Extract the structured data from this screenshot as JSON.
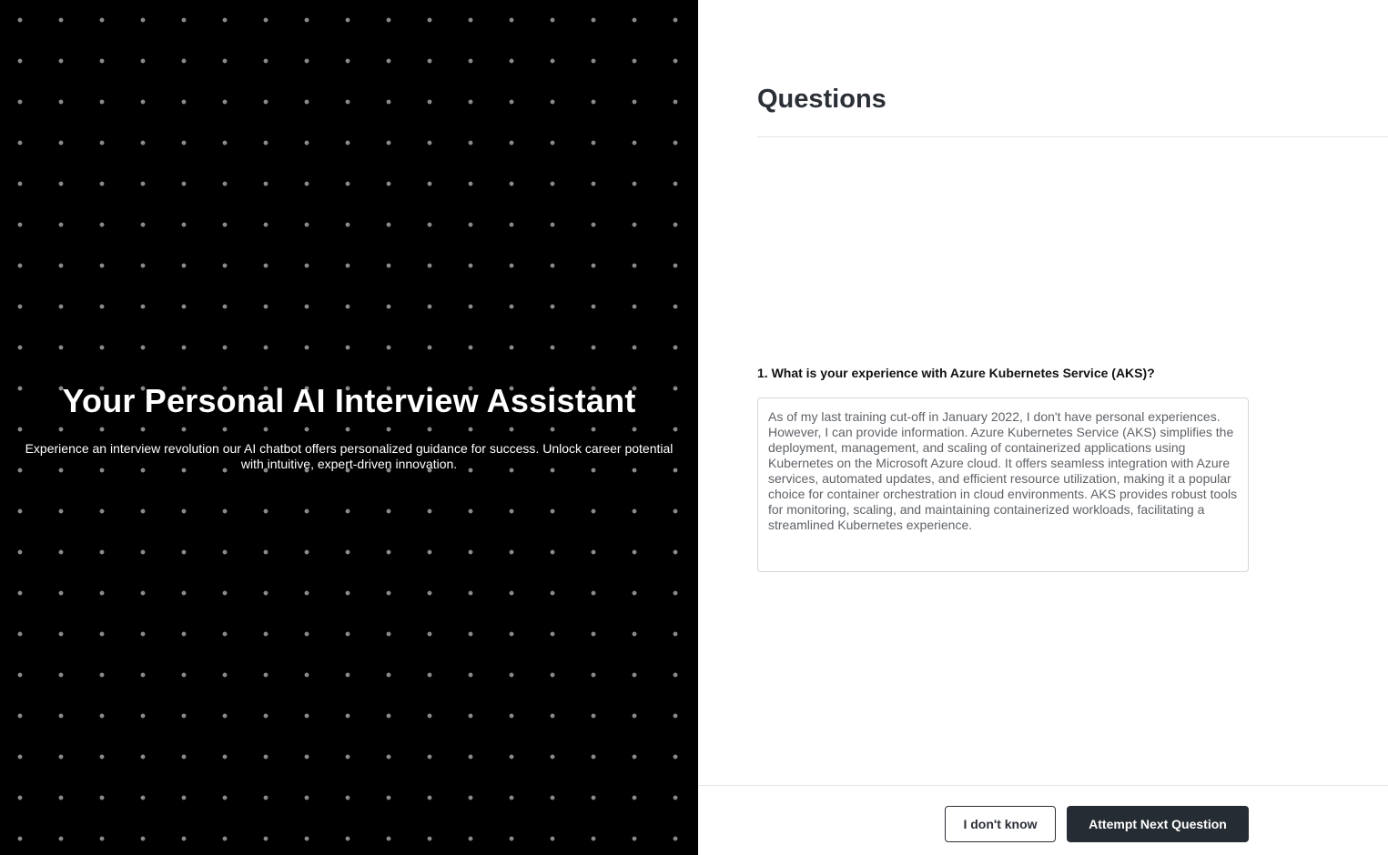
{
  "hero": {
    "title": "Your Personal AI Interview Assistant",
    "subtitle": "Experience an interview revolution our AI chatbot offers personalized guidance for success. Unlock career potential with intuitive, expert-driven innovation."
  },
  "panel": {
    "heading": "Questions",
    "question": {
      "number": "1.",
      "text": "1. What is your experience with Azure Kubernetes Service (AKS)?",
      "answer": "As of my last training cut-off in January 2022, I don't have personal experiences. However, I can provide information. Azure Kubernetes Service (AKS) simplifies the deployment, management, and scaling of containerized applications using Kubernetes on the Microsoft Azure cloud. It offers seamless integration with Azure services, automated updates, and efficient resource utilization, making it a popular choice for container orchestration in cloud environments. AKS provides robust tools for monitoring, scaling, and maintaining containerized workloads, facilitating a streamlined Kubernetes experience."
    }
  },
  "footer": {
    "idk_label": "I don't know",
    "next_label": "Attempt Next Question"
  },
  "colors": {
    "hero_background": "#000000",
    "dot": "#8a8a8a",
    "primary_button": "#262c33",
    "heading_text": "#2b2f36"
  }
}
